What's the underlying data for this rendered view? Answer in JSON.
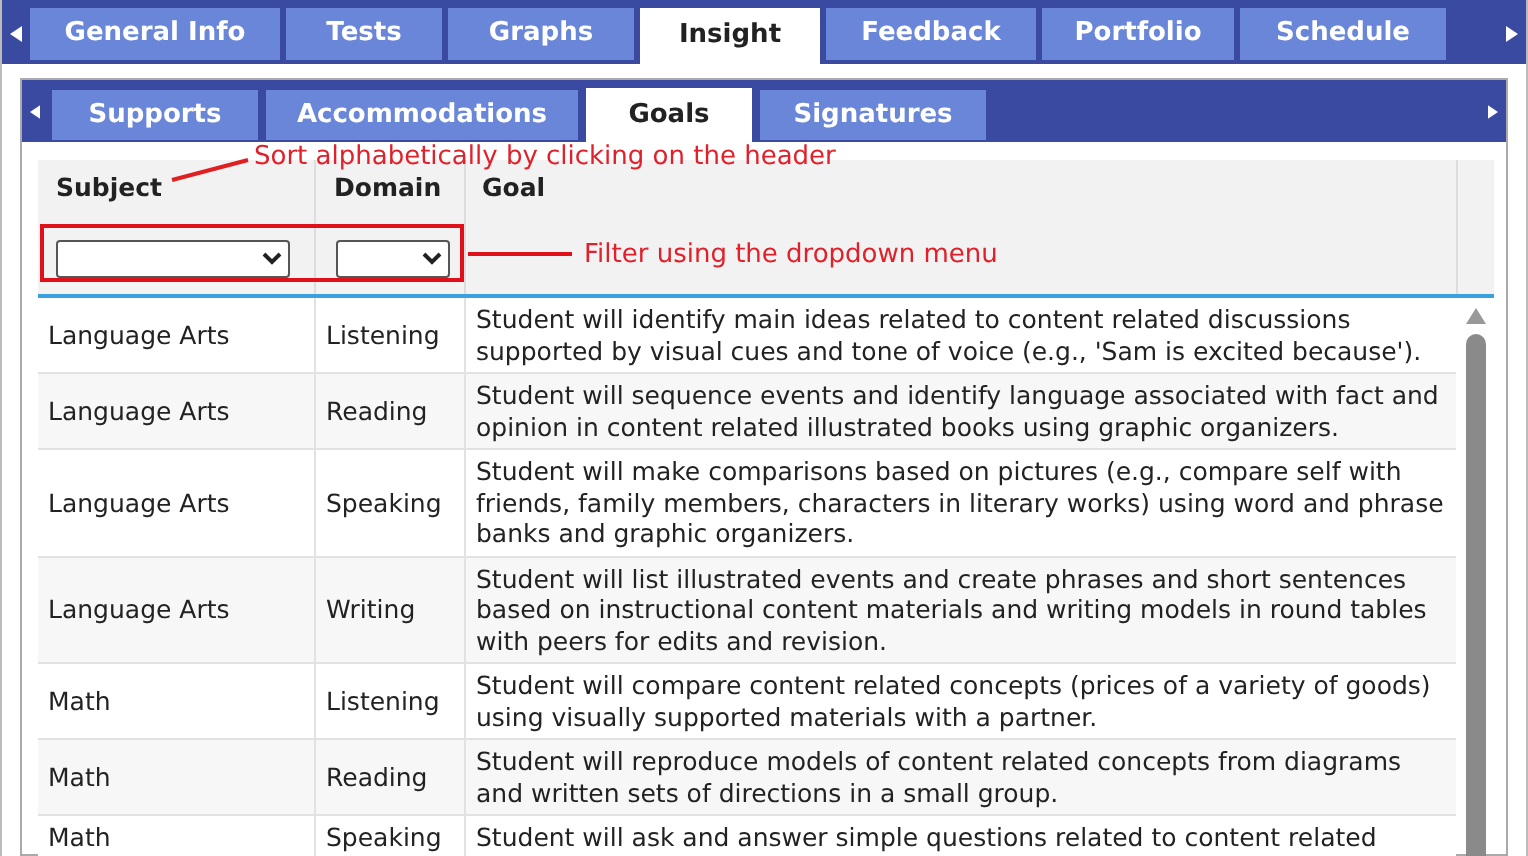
{
  "top_tabs": [
    {
      "label": "General Info",
      "selected": false
    },
    {
      "label": "Tests",
      "selected": false
    },
    {
      "label": "Graphs",
      "selected": false
    },
    {
      "label": "Insight",
      "selected": true
    },
    {
      "label": "Feedback",
      "selected": false
    },
    {
      "label": "Portfolio",
      "selected": false
    },
    {
      "label": "Schedule",
      "selected": false
    }
  ],
  "sub_tabs": [
    {
      "label": "Supports",
      "selected": false
    },
    {
      "label": "Accommodations",
      "selected": false
    },
    {
      "label": "Goals",
      "selected": true
    },
    {
      "label": "Signatures",
      "selected": false
    }
  ],
  "table": {
    "columns": [
      "Subject",
      "Domain",
      "Goal"
    ],
    "rows": [
      {
        "subject": "Language Arts",
        "domain": "Listening",
        "goal": "Student will identify main ideas related to content related discussions supported by visual cues and tone of voice (e.g., 'Sam is excited because')."
      },
      {
        "subject": "Language Arts",
        "domain": "Reading",
        "goal": "Student will sequence events and identify language associated with fact and opinion in content related illustrated books using graphic organizers."
      },
      {
        "subject": "Language Arts",
        "domain": "Speaking",
        "goal": "Student will make comparisons based on pictures (e.g., compare self with friends, family members, characters in literary works) using word and phrase banks and graphic organizers."
      },
      {
        "subject": "Language Arts",
        "domain": "Writing",
        "goal": "Student will list illustrated events and create phrases and short sentences based on instructional content materials and writing models in round tables with peers for edits and revision."
      },
      {
        "subject": "Math",
        "domain": "Listening",
        "goal": "Student will compare content related concepts (prices of a variety of goods) using visually supported materials with a partner."
      },
      {
        "subject": "Math",
        "domain": "Reading",
        "goal": "Student will reproduce models of content related concepts from diagrams and written sets of directions in a small group."
      },
      {
        "subject": "Math",
        "domain": "Speaking",
        "goal": "Student will ask and answer simple questions related to content related"
      }
    ]
  },
  "annotations": [
    {
      "text": "Sort alphabetically by clicking on the header"
    },
    {
      "text": "Filter using the dropdown menu"
    }
  ]
}
